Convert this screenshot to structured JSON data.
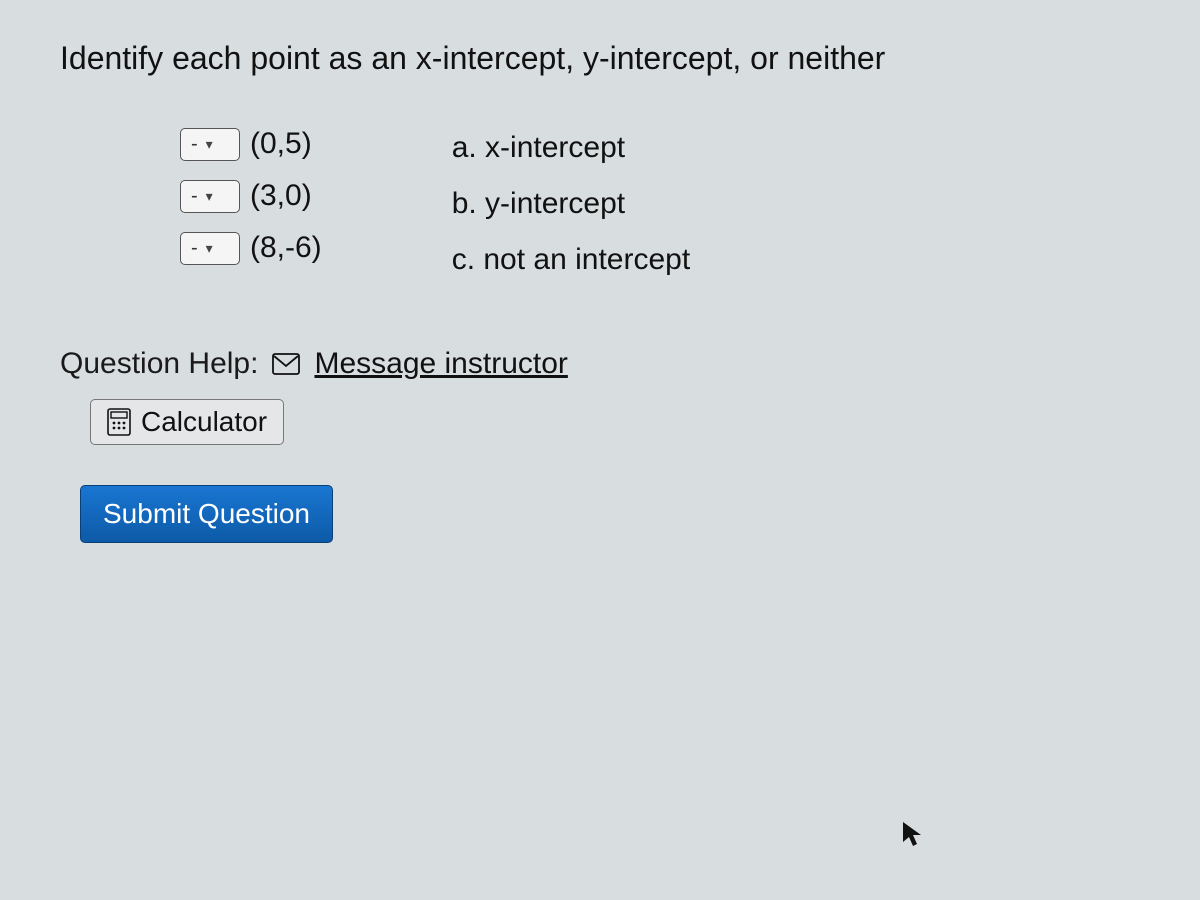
{
  "prompt": "Identify each point as an x-intercept, y-intercept, or neither",
  "items": [
    {
      "selected": "-",
      "point": "(0,5)"
    },
    {
      "selected": "-",
      "point": "(3,0)"
    },
    {
      "selected": "-",
      "point": "(8,-6)"
    }
  ],
  "choices": [
    "a. x-intercept",
    "b. y-intercept",
    "c. not an intercept"
  ],
  "help": {
    "label": "Question Help:",
    "message_link": "Message instructor",
    "calculator": "Calculator"
  },
  "submit": "Submit Question"
}
